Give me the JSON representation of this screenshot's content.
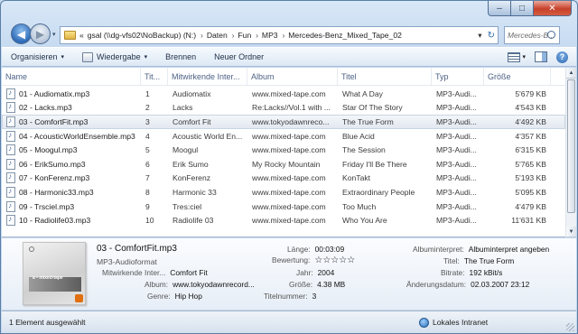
{
  "caption": {
    "minimize": "–",
    "maximize": "□",
    "close": "✕"
  },
  "nav": {
    "back": "◀",
    "forward": "▶",
    "dropdown": "▾"
  },
  "address": {
    "prefix": "«",
    "crumbs": [
      "gsal (\\\\dg-vfs02\\NoBackup) (N:)",
      "Daten",
      "Fun",
      "MP3",
      "Mercedes-Benz_Mixed_Tape_02"
    ],
    "separator": "›",
    "dropdown": "▾",
    "refresh": "↻"
  },
  "search": {
    "placeholder": "Mercedes-B..."
  },
  "toolbar": {
    "organize": "Organisieren",
    "playback": "Wiedergabe",
    "burn": "Brennen",
    "new_folder": "Neuer Ordner",
    "arrow": "▾",
    "help": "?"
  },
  "columns": [
    "Name",
    "Tit...",
    "Mitwirkende Inter...",
    "Album",
    "Titel",
    "Typ",
    "Größe"
  ],
  "files": [
    {
      "name": "01 - Audiomatix.mp3",
      "track": "1",
      "artist": "Audiomatix",
      "album": "www.mixed-tape.com",
      "title": "What A Day",
      "type": "MP3-Audi...",
      "size": "5'679 KB"
    },
    {
      "name": "02 - Lacks.mp3",
      "track": "2",
      "artist": "Lacks",
      "album": "Re:Lacks//Vol.1 with ...",
      "title": "Star Of The Story",
      "type": "MP3-Audi...",
      "size": "4'543 KB"
    },
    {
      "name": "03 - ComfortFit.mp3",
      "track": "3",
      "artist": "Comfort Fit",
      "album": "www.tokyodawnreco...",
      "title": "The True Form",
      "type": "MP3-Audi...",
      "size": "4'492 KB"
    },
    {
      "name": "04 - AcousticWorldEnsemble.mp3",
      "track": "4",
      "artist": "Acoustic World En...",
      "album": "www.mixed-tape.com",
      "title": "Blue Acid",
      "type": "MP3-Audi...",
      "size": "4'357 KB"
    },
    {
      "name": "05 - Moogul.mp3",
      "track": "5",
      "artist": "Moogul",
      "album": "www.mixed-tape.com",
      "title": "The Session",
      "type": "MP3-Audi...",
      "size": "6'315 KB"
    },
    {
      "name": "06 - ErikSumo.mp3",
      "track": "6",
      "artist": "Erik Sumo",
      "album": "My Rocky Mountain",
      "title": "Friday I'll Be There",
      "type": "MP3-Audi...",
      "size": "5'765 KB"
    },
    {
      "name": "07 - KonFerenz.mp3",
      "track": "7",
      "artist": "KonFerenz",
      "album": "www.mixed-tape.com",
      "title": "KonTakt",
      "type": "MP3-Audi...",
      "size": "5'193 KB"
    },
    {
      "name": "08 - Harmonic33.mp3",
      "track": "8",
      "artist": "Harmonic 33",
      "album": "www.mixed-tape.com",
      "title": "Extraordinary People",
      "type": "MP3-Audi...",
      "size": "5'095 KB"
    },
    {
      "name": "09 - Trsciel.mp3",
      "track": "9",
      "artist": "Tres:ciel",
      "album": "www.mixed-tape.com",
      "title": "Too Much",
      "type": "MP3-Audi...",
      "size": "4'479 KB"
    },
    {
      "name": "10 - Radiolife03.mp3",
      "track": "10",
      "artist": "Radiolife 03",
      "album": "www.mixed-tape.com",
      "title": "Who You Are",
      "type": "MP3-Audi...",
      "size": "11'631 KB"
    }
  ],
  "selected_index": 2,
  "details": {
    "title": "03 - ComfortFit.mp3",
    "format": "MP3-Audioformat",
    "thumb_text": "a • mixed-tape",
    "contributing_label": "Mitwirkende Inter...",
    "contributing": "Comfort Fit",
    "album_label": "Album:",
    "album": "www.tokyodawnrecord...",
    "genre_label": "Genre:",
    "genre": "Hip Hop",
    "length_label": "Länge:",
    "length": "00:03:09",
    "rating_label": "Bewertung:",
    "rating_stars": "☆☆☆☆☆",
    "year_label": "Jahr:",
    "year": "2004",
    "size_label": "Größe:",
    "size": "4.38 MB",
    "track_label": "Titelnummer:",
    "track": "3",
    "album_artist_label": "Albuminterpret:",
    "album_artist": "Albuminterpret angeben",
    "title_label": "Titel:",
    "title_value": "The True Form",
    "bitrate_label": "Bitrate:",
    "bitrate": "192 kBit/s",
    "modified_label": "Änderungsdatum:",
    "modified": "02.03.2007 23:12"
  },
  "status": {
    "left": "1 Element ausgewählt",
    "zone": "Lokales Intranet"
  }
}
